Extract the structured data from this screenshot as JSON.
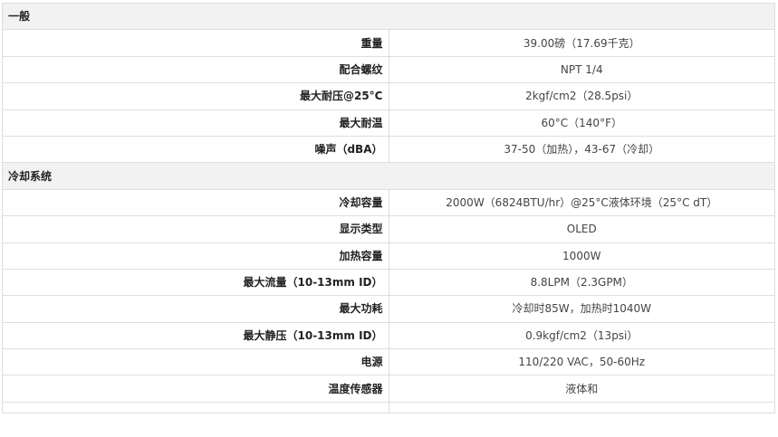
{
  "sections": [
    {
      "title": "一般",
      "rows": [
        {
          "label": "重量",
          "value": "39.00磅（17.69千克）"
        },
        {
          "label": "配合螺纹",
          "value": "NPT 1/4"
        },
        {
          "label": "最大耐压@25°C",
          "value": "2kgf/cm2（28.5psi）"
        },
        {
          "label": "最大耐温",
          "value": "60°C（140°F）"
        },
        {
          "label": "噪声（dBA）",
          "value": "37-50（加热），43-67（冷却）"
        }
      ]
    },
    {
      "title": "冷却系统",
      "rows": [
        {
          "label": "冷却容量",
          "value": "2000W（6824BTU/hr）@25°C液体环境（25°C dT）"
        },
        {
          "label": "显示类型",
          "value": "OLED"
        },
        {
          "label": "加热容量",
          "value": "1000W"
        },
        {
          "label": "最大流量（10-13mm ID）",
          "value": "8.8LPM（2.3GPM）"
        },
        {
          "label": "最大功耗",
          "value": "冷却时85W，加热时1040W"
        },
        {
          "label": "最大静压（10-13mm ID）",
          "value": "0.9kgf/cm2（13psi）"
        },
        {
          "label": "电源",
          "value": "110/220 VAC，50-60Hz"
        },
        {
          "label": "温度传感器",
          "value": "液体和"
        }
      ]
    }
  ]
}
